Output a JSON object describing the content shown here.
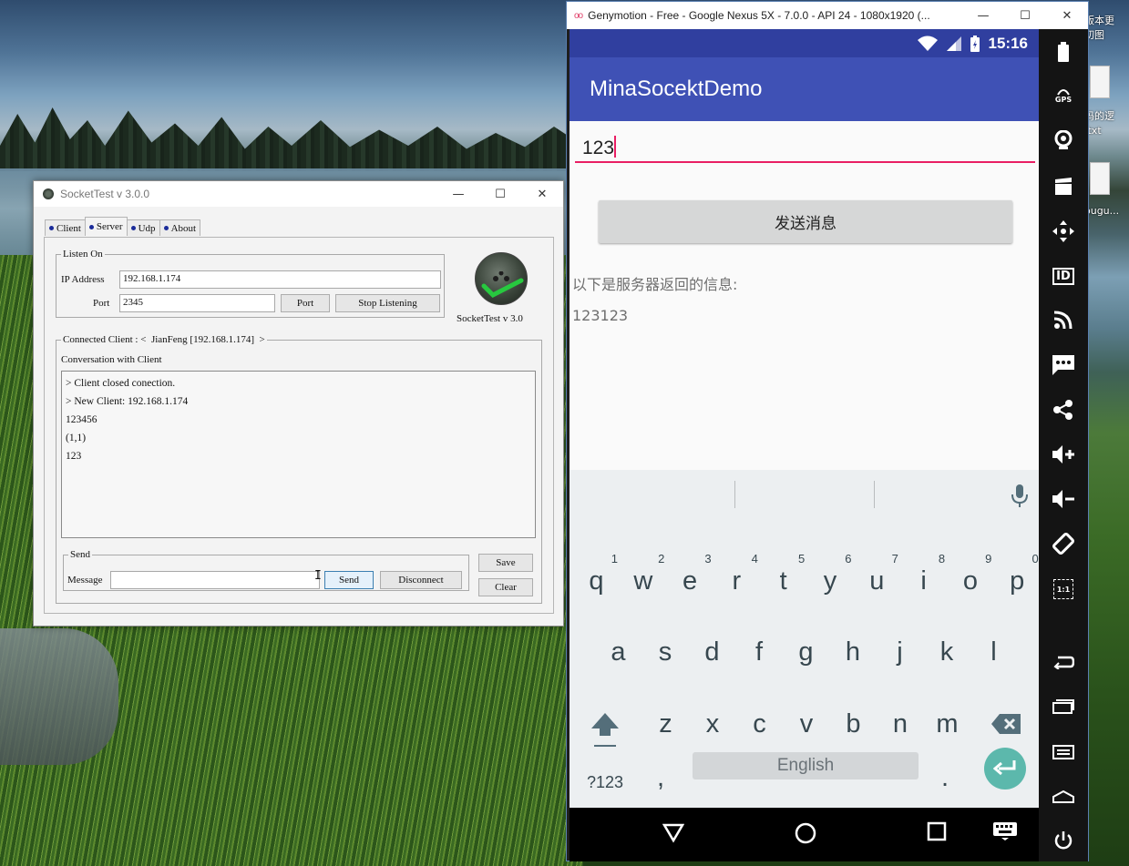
{
  "desktop": {
    "icon_labels": [
      "版本更",
      "切图",
      "码的逻",
      ".txt",
      "ougu..."
    ]
  },
  "sockettest": {
    "title": "SocketTest v 3.0.0",
    "tabs": [
      "Client",
      "Server",
      "Udp",
      "About"
    ],
    "active_tab": "Server",
    "listen_group": "Listen On",
    "ip_label": "IP Address",
    "ip_value": "192.168.1.174",
    "port_label": "Port",
    "port_value": "2345",
    "port_button": "Port",
    "stop_button": "Stop Listening",
    "logo_caption": "SocketTest v 3.0",
    "connected_label": "Connected Client : <  JianFeng [192.168.1.174]  >",
    "conversation_label": "Conversation with Client",
    "conversation_lines": [
      "> Client closed conection.",
      "> New Client: 192.168.1.174",
      "123456",
      "(1,1)",
      "123"
    ],
    "send_group": "Send",
    "message_label": "Message",
    "message_value": "",
    "send_button": "Send",
    "disconnect_button": "Disconnect",
    "save_button": "Save",
    "clear_button": "Clear"
  },
  "genymotion": {
    "title": "Genymotion - Free - Google Nexus 5X - 7.0.0 - API 24 - 1080x1920 (...",
    "status_time": "15:16",
    "app_title": "MinaSocektDemo",
    "input_value": "123",
    "send_button": "发送消息",
    "response_label": "以下是服务器返回的信息:",
    "response_value": "123123",
    "keyboard": {
      "row1": [
        [
          "q",
          "1"
        ],
        [
          "w",
          "2"
        ],
        [
          "e",
          "3"
        ],
        [
          "r",
          "4"
        ],
        [
          "t",
          "5"
        ],
        [
          "y",
          "6"
        ],
        [
          "u",
          "7"
        ],
        [
          "i",
          "8"
        ],
        [
          "o",
          "9"
        ],
        [
          "p",
          "0"
        ]
      ],
      "row2": [
        "a",
        "s",
        "d",
        "f",
        "g",
        "h",
        "j",
        "k",
        "l"
      ],
      "row3": [
        "z",
        "x",
        "c",
        "v",
        "b",
        "n",
        "m"
      ],
      "symbols_key": "?123",
      "comma_key": ",",
      "space_label": "English",
      "period_key": "."
    },
    "side_panel": [
      "battery-icon",
      "gps-icon",
      "webcam-icon",
      "capture-icon",
      "dpad-icon",
      "identity-icon",
      "network-icon",
      "sms-icon",
      "share-icon",
      "volume-up-icon",
      "volume-down-icon",
      "rotate-icon",
      "pixel-perfect-icon",
      "back-icon",
      "recent-apps-icon",
      "menu-icon",
      "home-icon",
      "power-icon"
    ],
    "gps_label": "GPS",
    "id_label": "ID",
    "pixel_label": "1:1"
  },
  "colors": {
    "status_bar": "#303f9f",
    "app_bar": "#3f51b5",
    "accent": "#e91e63",
    "enter_key": "#5cb8ac"
  }
}
